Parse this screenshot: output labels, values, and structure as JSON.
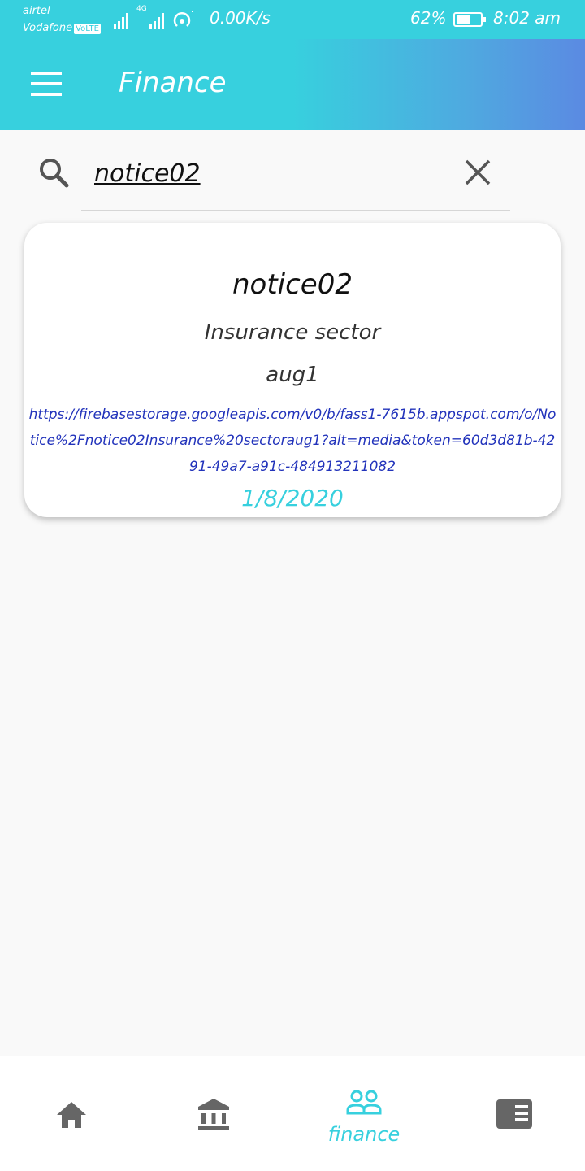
{
  "status_bar": {
    "carrier_1": "airtel",
    "carrier_2": "Vodafone",
    "volte_badge": "VoLTE",
    "network_type": "4G",
    "net_speed": "0.00K/s",
    "battery_percent": "62%",
    "battery_level": 0.62,
    "time": "8:02 am"
  },
  "app_bar": {
    "title": "Finance",
    "menu_icon": "hamburger-menu-icon"
  },
  "search": {
    "value": "notice02",
    "search_icon": "search-icon",
    "clear_icon": "close-icon"
  },
  "results": [
    {
      "title": "notice02",
      "sector": "Insurance sector",
      "file": "aug1",
      "url": "https://firebasestorage.googleapis.com/v0/b/fass1-7615b.appspot.com/o/Notice%2Fnotice02Insurance%20sectoraug1?alt=media&token=60d3d81b-4291-49a7-a91c-484913211082",
      "date": "1/8/2020"
    }
  ],
  "bottom_nav": {
    "items": [
      {
        "icon": "home-icon",
        "label": ""
      },
      {
        "icon": "bank-icon",
        "label": ""
      },
      {
        "icon": "people-icon",
        "label": "finance"
      },
      {
        "icon": "news-icon",
        "label": ""
      }
    ],
    "active_index": 2
  },
  "colors": {
    "accent": "#37d0de",
    "gradient_end": "#5b8ae2",
    "link": "#2233bb",
    "icon_gray": "#666666"
  }
}
